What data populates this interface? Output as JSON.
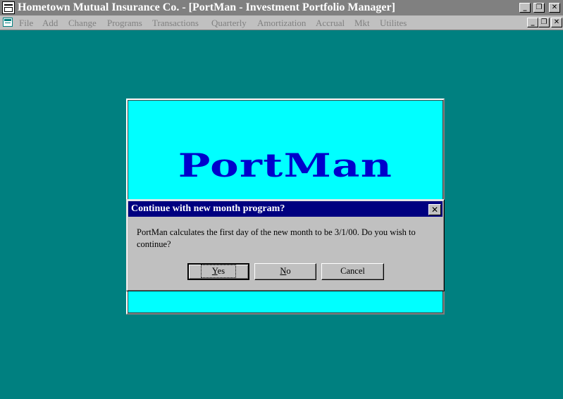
{
  "window": {
    "title": "Hometown Mutual Insurance Co. - [PortMan - Investment Portfolio Manager]",
    "controls": {
      "minimize": "_",
      "restore": "❐",
      "close": "✕"
    }
  },
  "menu": {
    "items": [
      {
        "label": "File"
      },
      {
        "label": "Add"
      },
      {
        "label": "Change"
      },
      {
        "label": "Programs"
      },
      {
        "label": "Transactions"
      },
      {
        "label": "Quarterly"
      },
      {
        "label": "Amortization"
      },
      {
        "label": "Accrual"
      },
      {
        "label": "Mkt"
      },
      {
        "label": "Utilites"
      }
    ],
    "doc_controls": {
      "minimize": "_",
      "restore": "❐",
      "close": "✕"
    }
  },
  "splash": {
    "logo": "PortMan"
  },
  "dialog": {
    "title": "Continue with new month program?",
    "close": "✕",
    "message": "PortMan calculates the first day of the new month to be 3/1/00. Do you wish to continue?",
    "buttons": {
      "yes": {
        "mnemonic": "Y",
        "rest": "es"
      },
      "no": {
        "mnemonic": "N",
        "rest": "o"
      },
      "cancel": {
        "label": "Cancel"
      }
    }
  },
  "colors": {
    "workspace": "#008080",
    "splash_bg": "#00ffff",
    "logo": "#0000cc",
    "dialog_title_bar": "#000080",
    "app_title_bar_inactive": "#808080"
  }
}
